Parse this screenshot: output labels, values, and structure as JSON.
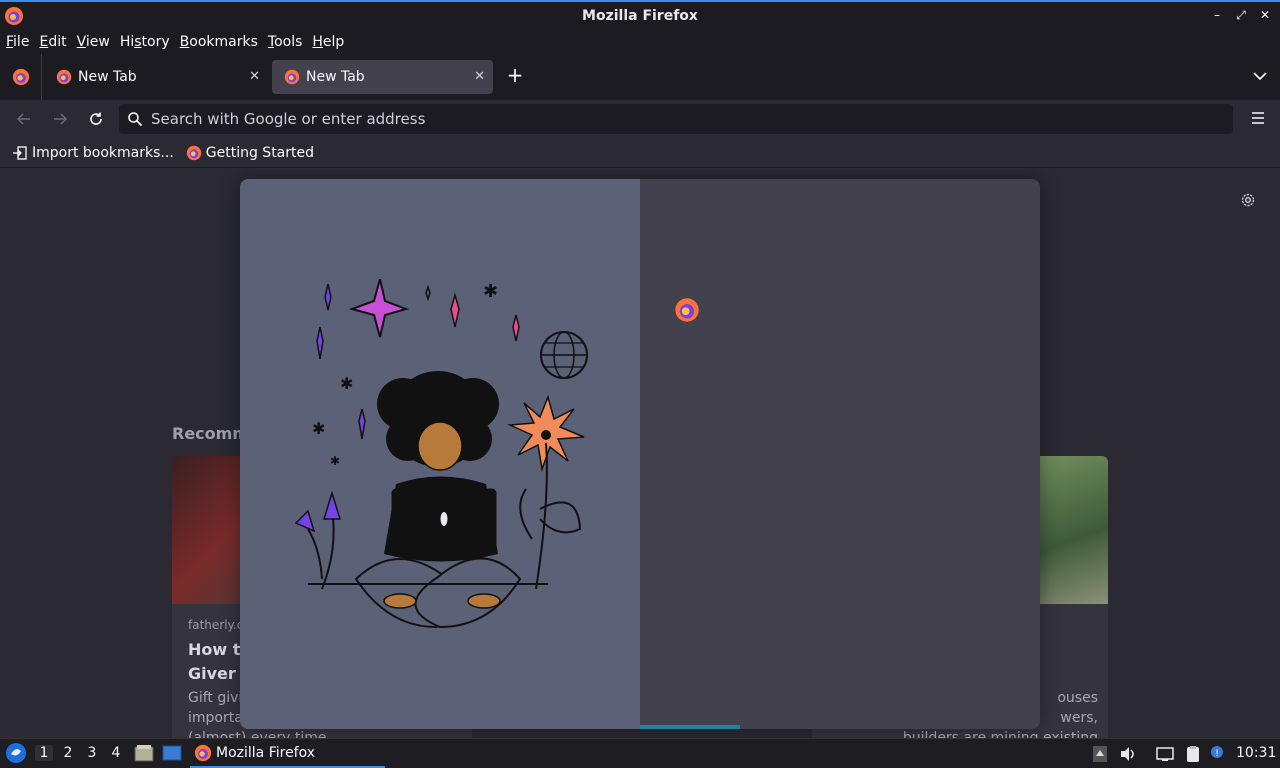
{
  "window": {
    "title": "Mozilla Firefox"
  },
  "menubar": {
    "items": [
      {
        "mnemonic": "F",
        "rest": "ile"
      },
      {
        "mnemonic": "E",
        "rest": "dit"
      },
      {
        "mnemonic": "V",
        "rest": "iew"
      },
      {
        "mnemonic": "",
        "pre": "Hi",
        "mn2": "s",
        "rest": "tory"
      },
      {
        "mnemonic": "B",
        "rest": "ookmarks"
      },
      {
        "mnemonic": "T",
        "rest": "ools"
      },
      {
        "mnemonic": "H",
        "rest": "elp"
      }
    ]
  },
  "tabs": [
    {
      "label": "New Tab",
      "active": false
    },
    {
      "label": "New Tab",
      "active": true
    }
  ],
  "urlbar": {
    "placeholder": "Search with Google or enter address"
  },
  "bookmarks": [
    {
      "label": "Import bookmarks...",
      "icon": "import-icon"
    },
    {
      "label": "Getting Started",
      "icon": "firefox-icon"
    }
  ],
  "newtab": {
    "recommended_heading": "Recomm",
    "cards": [
      {
        "source": "fatherly.c",
        "title": "How to\nGiver",
        "desc": "Gift givin\nimporta\n(almost) every time"
      },
      {
        "source": "",
        "title": "",
        "desc": "ouses\nwers,\nbuilders are mining existing structures"
      }
    ]
  },
  "taskbar": {
    "workspaces": [
      "1",
      "2",
      "3",
      "4"
    ],
    "active_workspace": "1",
    "task_label": "Mozilla Firefox",
    "clock": "10:31"
  },
  "colors": {
    "accent": "#3a8ee6",
    "chrome_dark": "#1c1b22",
    "chrome": "#2b2a33",
    "modal_left": "#5b6176",
    "modal_right": "#42414d"
  }
}
